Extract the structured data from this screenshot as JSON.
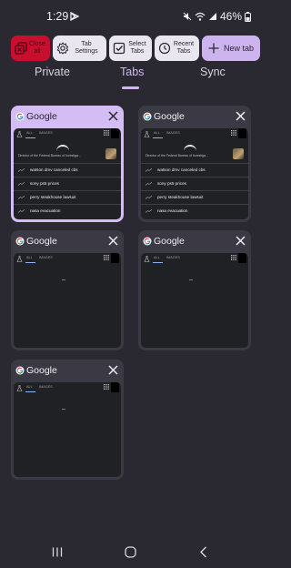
{
  "status": {
    "time": "1:29",
    "battery": "46%"
  },
  "toolbar": {
    "close_all": "Close all",
    "tab_settings": "Tab Settings",
    "select_tabs": "Select Tabs",
    "recent_tabs": "Recent Tabs",
    "new_tab": "New tab"
  },
  "nav": {
    "private": "Private",
    "tabs": "Tabs",
    "sync": "Sync"
  },
  "tabs": [
    {
      "title": "Google",
      "active": true,
      "search": {
        "all": "ALL",
        "images": "IMAGES",
        "hero": "Director of the Federal Bureau of Investiga...",
        "trends": [
          "watson dmv canceled cbs",
          "sony ps5 prices",
          "perry steakhouse lawsuit",
          "nasa evacuation"
        ]
      }
    },
    {
      "title": "Google",
      "active": false,
      "search": {
        "all": "ALL",
        "images": "IMAGES",
        "hero": "Director of the Federal Bureau of Investiga...",
        "trends": [
          "watson dmv canceled cbs",
          "sony ps5 prices",
          "perry steakhouse lawsuit",
          "nasa evacuation"
        ]
      }
    },
    {
      "title": "Google",
      "active": false,
      "search": {
        "all": "ALL",
        "images": "IMAGES"
      }
    },
    {
      "title": "Google",
      "active": false,
      "search": {
        "all": "ALL",
        "images": "IMAGES"
      }
    },
    {
      "title": "Google",
      "active": false,
      "search": {
        "all": "ALL",
        "images": "IMAGES"
      }
    }
  ],
  "colors": {
    "accent": "#cfb8f0",
    "danger": "#c8102e",
    "background": "#2a2931"
  }
}
